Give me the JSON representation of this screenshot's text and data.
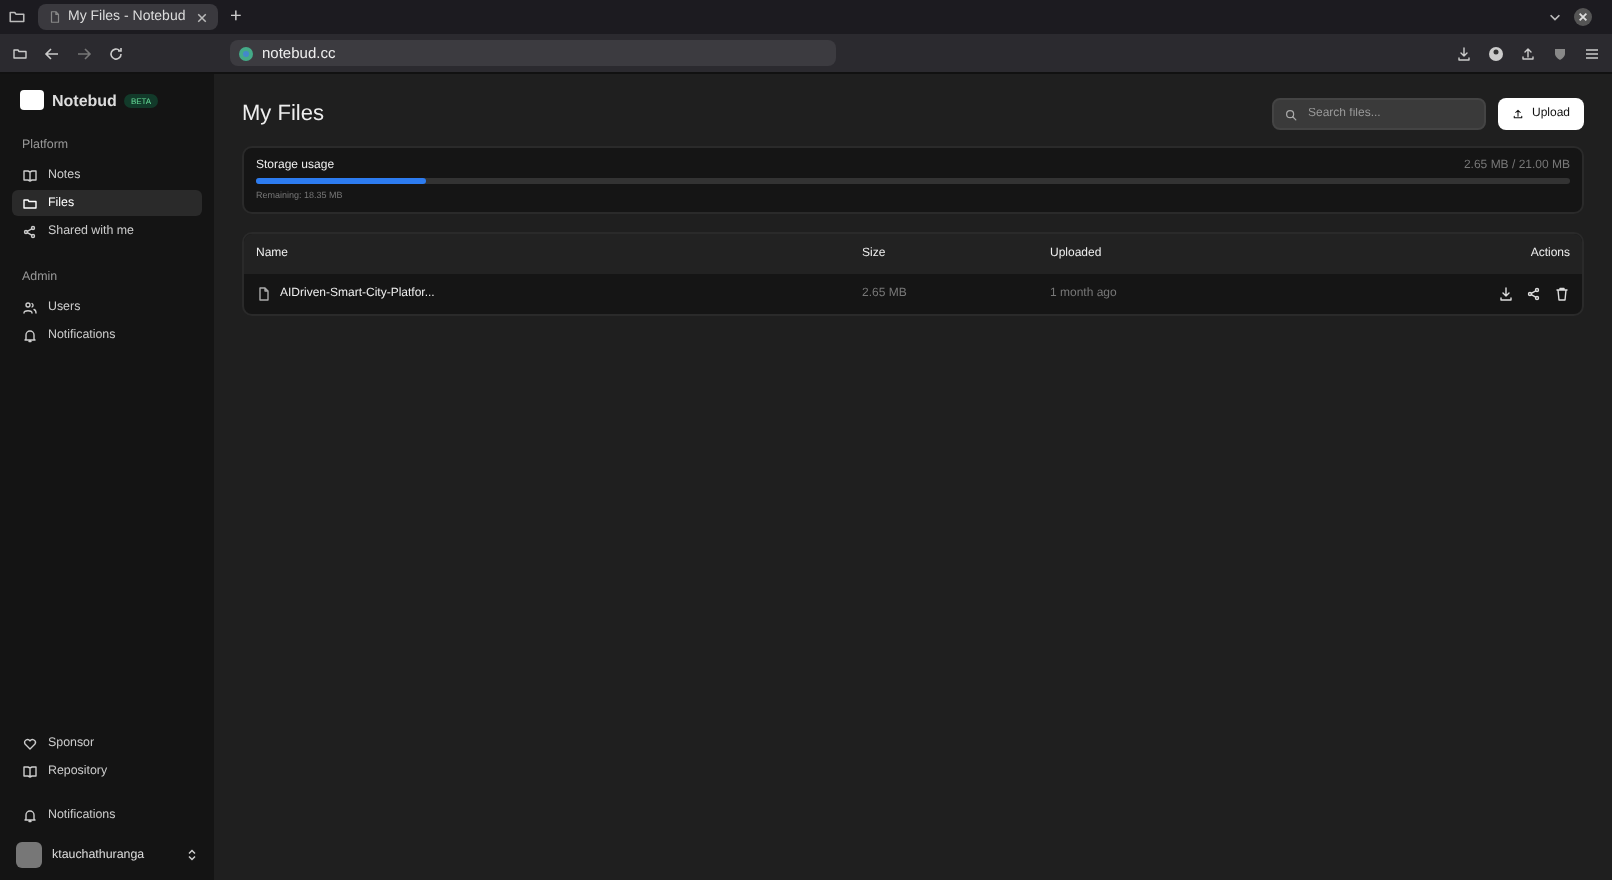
{
  "browser": {
    "tab_title": "My Files - Notebud",
    "new_tab": "+",
    "url": "notebud.cc"
  },
  "sidebar": {
    "brand": "Notebud",
    "badge": "BETA",
    "groups": [
      {
        "title": "Platform",
        "items": [
          {
            "label": "Notes",
            "kind": "book",
            "selected": false
          },
          {
            "label": "Files",
            "kind": "folder",
            "selected": true
          },
          {
            "label": "Shared with me",
            "kind": "share",
            "selected": false
          }
        ]
      },
      {
        "title": "Admin",
        "items": [
          {
            "label": "Users",
            "kind": "users",
            "selected": false
          },
          {
            "label": "Notifications",
            "kind": "bell",
            "selected": false
          }
        ]
      }
    ],
    "footer_links": [
      {
        "label": "Sponsor",
        "kind": "heart"
      },
      {
        "label": "Repository",
        "kind": "book"
      }
    ],
    "notifications": "Notifications",
    "user": "ktauchathuranga"
  },
  "page": {
    "title": "My Files",
    "search": {
      "placeholder": "Search files..."
    },
    "upload": "Upload",
    "storage": {
      "title": "Storage usage",
      "reading": "2.65 MB / 21.00 MB",
      "level": 0.13,
      "remaining": "Remaining: 18.35 MB"
    },
    "table": {
      "columns": [
        "Name",
        "Size",
        "Uploaded",
        "Actions"
      ],
      "rows": [
        {
          "name": "AIDriven-Smart-City-Platfor...",
          "size": "2.65 MB",
          "uploaded": "1 month ago"
        }
      ]
    }
  }
}
